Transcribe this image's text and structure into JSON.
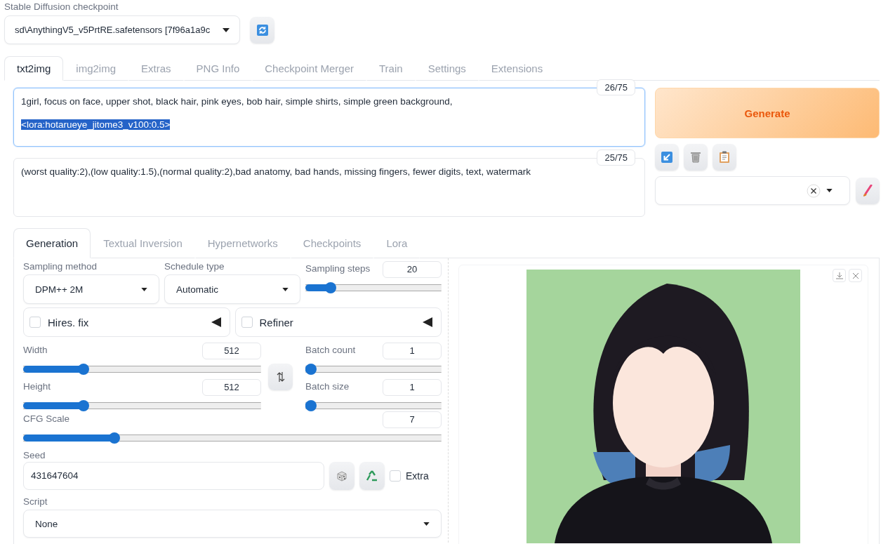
{
  "checkpoint": {
    "label": "Stable Diffusion checkpoint",
    "value": "sd\\AnythingV5_v5PrtRE.safetensors [7f96a1a9c"
  },
  "tabs": [
    {
      "label": "txt2img",
      "selected": true
    },
    {
      "label": "img2img",
      "selected": false
    },
    {
      "label": "Extras",
      "selected": false
    },
    {
      "label": "PNG Info",
      "selected": false
    },
    {
      "label": "Checkpoint Merger",
      "selected": false
    },
    {
      "label": "Train",
      "selected": false
    },
    {
      "label": "Settings",
      "selected": false
    },
    {
      "label": "Extensions",
      "selected": false
    }
  ],
  "prompt": {
    "focused": true,
    "token_count": "26/75",
    "lines": [
      {
        "text": "1girl, focus on face, upper shot, black hair, pink eyes, bob hair, simple shirts, simple green background,",
        "selected": false
      },
      {
        "text": "<lora:hotarueye_jitome3_v100:0.5>",
        "selected": true
      }
    ]
  },
  "negative_prompt": {
    "focused": false,
    "token_count": "25/75",
    "lines": [
      {
        "text": "(worst quality:2),(low quality:1.5),(normal quality:2),bad anatomy, bad hands, missing fingers, fewer digits, text, watermark",
        "selected": false
      }
    ]
  },
  "generate_button": "Generate",
  "subtabs": [
    {
      "label": "Generation",
      "selected": true
    },
    {
      "label": "Textual Inversion",
      "selected": false
    },
    {
      "label": "Hypernetworks",
      "selected": false
    },
    {
      "label": "Checkpoints",
      "selected": false
    },
    {
      "label": "Lora",
      "selected": false
    }
  ],
  "sampling_method": {
    "label": "Sampling method",
    "value": "DPM++ 2M"
  },
  "schedule_type": {
    "label": "Schedule type",
    "value": "Automatic"
  },
  "sampling_steps": {
    "label": "Sampling steps",
    "value": "20",
    "level": 0.16
  },
  "accordions": [
    {
      "label": "Hires. fix",
      "checked": false
    },
    {
      "label": "Refiner",
      "checked": false
    }
  ],
  "width": {
    "label": "Width",
    "value": "512",
    "level": 0.24
  },
  "height": {
    "label": "Height",
    "value": "512",
    "level": 0.24
  },
  "batch_count": {
    "label": "Batch count",
    "value": "1",
    "level": 0
  },
  "batch_size": {
    "label": "Batch size",
    "value": "1",
    "level": 0
  },
  "cfg_scale": {
    "label": "CFG Scale",
    "value": "7",
    "level": 0.21
  },
  "seed": {
    "label": "Seed",
    "value": "431647604"
  },
  "extra": {
    "label": "Extra",
    "checked": false
  },
  "script": {
    "label": "Script",
    "value": "None"
  }
}
